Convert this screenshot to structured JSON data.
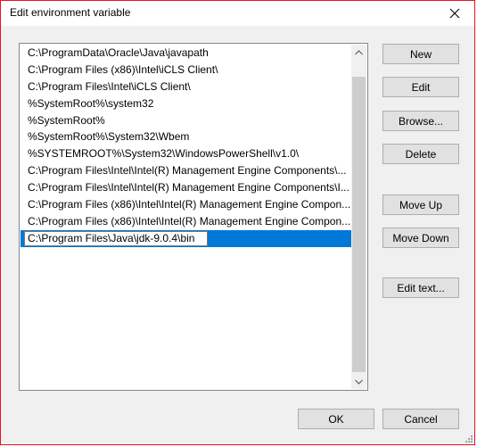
{
  "window": {
    "title": "Edit environment variable"
  },
  "list": {
    "items": [
      "C:\\ProgramData\\Oracle\\Java\\javapath",
      "C:\\Program Files (x86)\\Intel\\iCLS Client\\",
      "C:\\Program Files\\Intel\\iCLS Client\\",
      "%SystemRoot%\\system32",
      "%SystemRoot%",
      "%SystemRoot%\\System32\\Wbem",
      "%SYSTEMROOT%\\System32\\WindowsPowerShell\\v1.0\\",
      "C:\\Program Files\\Intel\\Intel(R) Management Engine Components\\...",
      "C:\\Program Files\\Intel\\Intel(R) Management Engine Components\\I...",
      "C:\\Program Files (x86)\\Intel\\Intel(R) Management Engine Compon...",
      "C:\\Program Files (x86)\\Intel\\Intel(R) Management Engine Compon..."
    ],
    "editing_value": "C:\\Program Files\\Java\\jdk-9.0.4\\bin"
  },
  "buttons": {
    "new": "New",
    "edit": "Edit",
    "browse": "Browse...",
    "delete": "Delete",
    "move_up": "Move Up",
    "move_down": "Move Down",
    "edit_text": "Edit text...",
    "ok": "OK",
    "cancel": "Cancel"
  },
  "colors": {
    "selection": "#0078d7",
    "window_border": "#e81123",
    "dialog_background": "#f0f0f0",
    "button_face": "#e1e1e1"
  },
  "icons": {
    "close": "close-icon",
    "scroll_up": "chevron-up-icon",
    "scroll_down": "chevron-down-icon",
    "resize": "resize-grip-icon"
  }
}
